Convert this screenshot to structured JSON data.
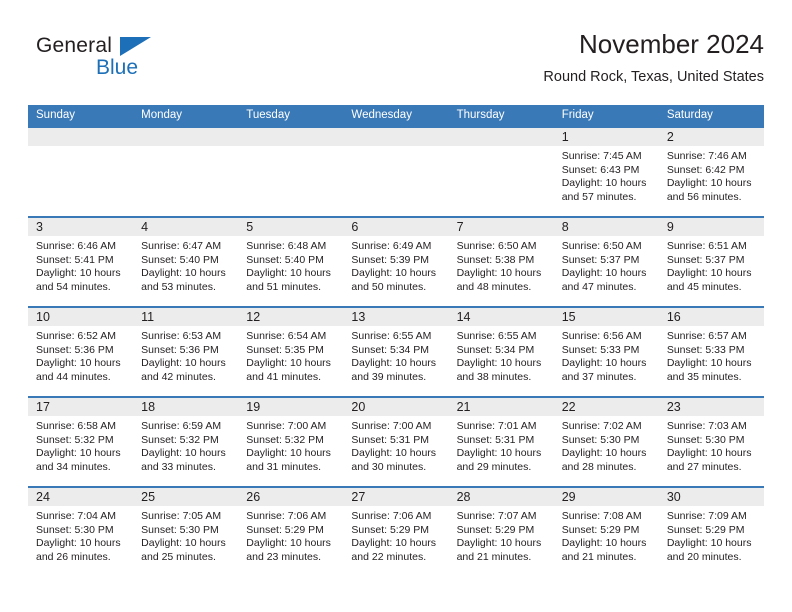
{
  "logo": {
    "word_one": "General",
    "word_two": "Blue",
    "triangle_icon": "blue-triangle-icon",
    "brand_color": "#1d70b7"
  },
  "header": {
    "title": "November 2024",
    "subtitle": "Round Rock, Texas, United States"
  },
  "theme": {
    "header_blue": "#3a79b8",
    "daynum_band_gray": "#ececec",
    "text": "#231f20"
  },
  "weekdays": [
    "Sunday",
    "Monday",
    "Tuesday",
    "Wednesday",
    "Thursday",
    "Friday",
    "Saturday"
  ],
  "weeks": [
    [
      {
        "day": "",
        "empty": true
      },
      {
        "day": "",
        "empty": true
      },
      {
        "day": "",
        "empty": true
      },
      {
        "day": "",
        "empty": true
      },
      {
        "day": "",
        "empty": true
      },
      {
        "day": "1",
        "sunrise": "Sunrise: 7:45 AM",
        "sunset": "Sunset: 6:43 PM",
        "daylight": "Daylight: 10 hours and 57 minutes."
      },
      {
        "day": "2",
        "sunrise": "Sunrise: 7:46 AM",
        "sunset": "Sunset: 6:42 PM",
        "daylight": "Daylight: 10 hours and 56 minutes."
      }
    ],
    [
      {
        "day": "3",
        "sunrise": "Sunrise: 6:46 AM",
        "sunset": "Sunset: 5:41 PM",
        "daylight": "Daylight: 10 hours and 54 minutes."
      },
      {
        "day": "4",
        "sunrise": "Sunrise: 6:47 AM",
        "sunset": "Sunset: 5:40 PM",
        "daylight": "Daylight: 10 hours and 53 minutes."
      },
      {
        "day": "5",
        "sunrise": "Sunrise: 6:48 AM",
        "sunset": "Sunset: 5:40 PM",
        "daylight": "Daylight: 10 hours and 51 minutes."
      },
      {
        "day": "6",
        "sunrise": "Sunrise: 6:49 AM",
        "sunset": "Sunset: 5:39 PM",
        "daylight": "Daylight: 10 hours and 50 minutes."
      },
      {
        "day": "7",
        "sunrise": "Sunrise: 6:50 AM",
        "sunset": "Sunset: 5:38 PM",
        "daylight": "Daylight: 10 hours and 48 minutes."
      },
      {
        "day": "8",
        "sunrise": "Sunrise: 6:50 AM",
        "sunset": "Sunset: 5:37 PM",
        "daylight": "Daylight: 10 hours and 47 minutes."
      },
      {
        "day": "9",
        "sunrise": "Sunrise: 6:51 AM",
        "sunset": "Sunset: 5:37 PM",
        "daylight": "Daylight: 10 hours and 45 minutes."
      }
    ],
    [
      {
        "day": "10",
        "sunrise": "Sunrise: 6:52 AM",
        "sunset": "Sunset: 5:36 PM",
        "daylight": "Daylight: 10 hours and 44 minutes."
      },
      {
        "day": "11",
        "sunrise": "Sunrise: 6:53 AM",
        "sunset": "Sunset: 5:36 PM",
        "daylight": "Daylight: 10 hours and 42 minutes."
      },
      {
        "day": "12",
        "sunrise": "Sunrise: 6:54 AM",
        "sunset": "Sunset: 5:35 PM",
        "daylight": "Daylight: 10 hours and 41 minutes."
      },
      {
        "day": "13",
        "sunrise": "Sunrise: 6:55 AM",
        "sunset": "Sunset: 5:34 PM",
        "daylight": "Daylight: 10 hours and 39 minutes."
      },
      {
        "day": "14",
        "sunrise": "Sunrise: 6:55 AM",
        "sunset": "Sunset: 5:34 PM",
        "daylight": "Daylight: 10 hours and 38 minutes."
      },
      {
        "day": "15",
        "sunrise": "Sunrise: 6:56 AM",
        "sunset": "Sunset: 5:33 PM",
        "daylight": "Daylight: 10 hours and 37 minutes."
      },
      {
        "day": "16",
        "sunrise": "Sunrise: 6:57 AM",
        "sunset": "Sunset: 5:33 PM",
        "daylight": "Daylight: 10 hours and 35 minutes."
      }
    ],
    [
      {
        "day": "17",
        "sunrise": "Sunrise: 6:58 AM",
        "sunset": "Sunset: 5:32 PM",
        "daylight": "Daylight: 10 hours and 34 minutes."
      },
      {
        "day": "18",
        "sunrise": "Sunrise: 6:59 AM",
        "sunset": "Sunset: 5:32 PM",
        "daylight": "Daylight: 10 hours and 33 minutes."
      },
      {
        "day": "19",
        "sunrise": "Sunrise: 7:00 AM",
        "sunset": "Sunset: 5:32 PM",
        "daylight": "Daylight: 10 hours and 31 minutes."
      },
      {
        "day": "20",
        "sunrise": "Sunrise: 7:00 AM",
        "sunset": "Sunset: 5:31 PM",
        "daylight": "Daylight: 10 hours and 30 minutes."
      },
      {
        "day": "21",
        "sunrise": "Sunrise: 7:01 AM",
        "sunset": "Sunset: 5:31 PM",
        "daylight": "Daylight: 10 hours and 29 minutes."
      },
      {
        "day": "22",
        "sunrise": "Sunrise: 7:02 AM",
        "sunset": "Sunset: 5:30 PM",
        "daylight": "Daylight: 10 hours and 28 minutes."
      },
      {
        "day": "23",
        "sunrise": "Sunrise: 7:03 AM",
        "sunset": "Sunset: 5:30 PM",
        "daylight": "Daylight: 10 hours and 27 minutes."
      }
    ],
    [
      {
        "day": "24",
        "sunrise": "Sunrise: 7:04 AM",
        "sunset": "Sunset: 5:30 PM",
        "daylight": "Daylight: 10 hours and 26 minutes."
      },
      {
        "day": "25",
        "sunrise": "Sunrise: 7:05 AM",
        "sunset": "Sunset: 5:30 PM",
        "daylight": "Daylight: 10 hours and 25 minutes."
      },
      {
        "day": "26",
        "sunrise": "Sunrise: 7:06 AM",
        "sunset": "Sunset: 5:29 PM",
        "daylight": "Daylight: 10 hours and 23 minutes."
      },
      {
        "day": "27",
        "sunrise": "Sunrise: 7:06 AM",
        "sunset": "Sunset: 5:29 PM",
        "daylight": "Daylight: 10 hours and 22 minutes."
      },
      {
        "day": "28",
        "sunrise": "Sunrise: 7:07 AM",
        "sunset": "Sunset: 5:29 PM",
        "daylight": "Daylight: 10 hours and 21 minutes."
      },
      {
        "day": "29",
        "sunrise": "Sunrise: 7:08 AM",
        "sunset": "Sunset: 5:29 PM",
        "daylight": "Daylight: 10 hours and 21 minutes."
      },
      {
        "day": "30",
        "sunrise": "Sunrise: 7:09 AM",
        "sunset": "Sunset: 5:29 PM",
        "daylight": "Daylight: 10 hours and 20 minutes."
      }
    ]
  ]
}
